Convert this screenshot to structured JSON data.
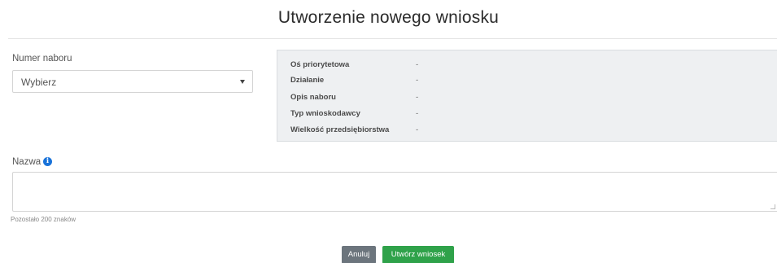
{
  "header": {
    "title": "Utworzenie nowego wniosku"
  },
  "form": {
    "numer_naboru": {
      "label": "Numer naboru",
      "selected": "Wybierz"
    },
    "info_panel": {
      "rows": [
        {
          "label": "Oś priorytetowa",
          "value": "-"
        },
        {
          "label": "Działanie",
          "value": "-"
        },
        {
          "label": "Opis naboru",
          "value": "-"
        },
        {
          "label": "Typ wnioskodawcy",
          "value": "-"
        },
        {
          "label": "Wielkość przedsiębiorstwa",
          "value": "-"
        }
      ]
    },
    "nazwa": {
      "label": "Nazwa",
      "value": "",
      "hint": "Pozostało 200 znaków"
    }
  },
  "buttons": {
    "cancel_label": "Anuluj",
    "create_label": "Utwórz wniosek"
  },
  "colors": {
    "cancel": "#6c757d",
    "create": "#2fa24a",
    "info_icon": "#1a73d9",
    "panel_bg": "#eef0f2"
  },
  "icons": {
    "info": "info-circle-icon",
    "dropdown": "chevron-down-icon"
  }
}
